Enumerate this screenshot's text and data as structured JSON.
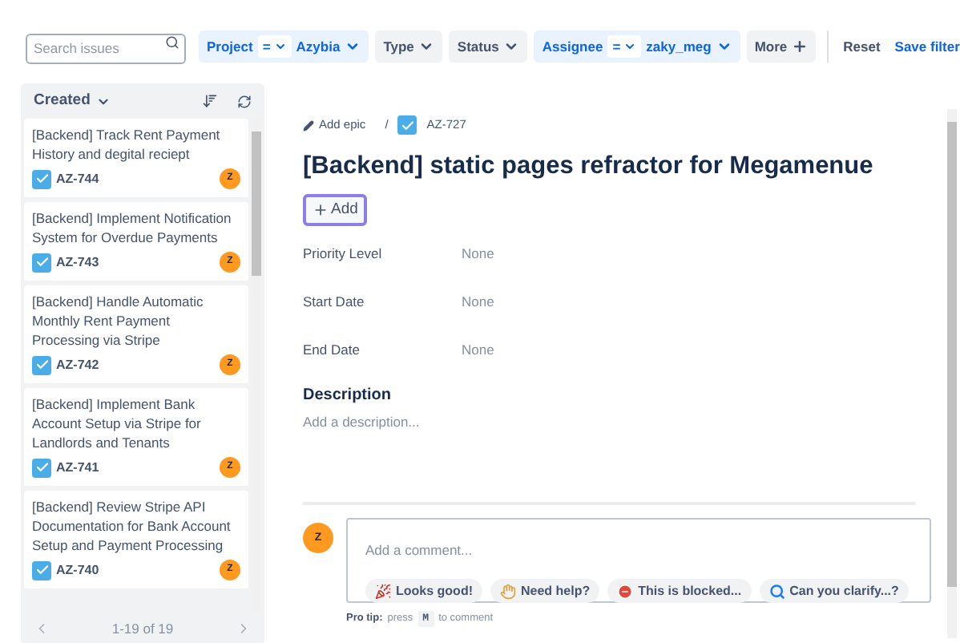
{
  "filters": {
    "search": {
      "placeholder": "Search issues"
    },
    "chips": [
      {
        "kind": "field",
        "label": "Project",
        "operator": "=",
        "value": "Azybia",
        "active": true
      },
      {
        "kind": "simple",
        "label": "Type",
        "active": false
      },
      {
        "kind": "simple",
        "label": "Status",
        "active": false
      },
      {
        "kind": "field",
        "label": "Assignee",
        "operator": "=",
        "value": "zaky_meg",
        "active": true
      },
      {
        "kind": "more",
        "label": "More",
        "active": false
      }
    ],
    "reset": "Reset",
    "save": "Save filter"
  },
  "issue_list": {
    "sort": "Created",
    "items": [
      {
        "title": "[Backend] Track Rent Payment History and degital reciept",
        "key": "AZ-744",
        "avatar": "Z"
      },
      {
        "title": "[Backend] Implement Notification System for Overdue Payments",
        "key": "AZ-743",
        "avatar": "Z"
      },
      {
        "title": "[Backend] Handle Automatic Monthly Rent Payment Processing via Stripe",
        "key": "AZ-742",
        "avatar": "Z"
      },
      {
        "title": "[Backend] Implement Bank Account Setup via Stripe for Landlords and Tenants",
        "key": "AZ-741",
        "avatar": "Z"
      },
      {
        "title": "[Backend] Review Stripe API Documentation for Bank Account Setup and Payment Processing",
        "key": "AZ-740",
        "avatar": "Z"
      }
    ],
    "pagination": "1-19 of 19"
  },
  "issue": {
    "breadcrumb": {
      "epic": "Add epic",
      "separator": "/",
      "key": "AZ-727"
    },
    "title": "[Backend] static pages refractor for Megamenue",
    "add_button": "Add",
    "fields": [
      {
        "label": "Priority Level",
        "value": "None"
      },
      {
        "label": "Start Date",
        "value": "None"
      },
      {
        "label": "End Date",
        "value": "None"
      }
    ],
    "description": {
      "heading": "Description",
      "placeholder": "Add a description..."
    },
    "comment": {
      "avatar": "Z",
      "placeholder": "Add a comment...",
      "quick_replies": [
        {
          "kind": "party",
          "label": "Looks good!"
        },
        {
          "kind": "wave",
          "label": "Need help?"
        },
        {
          "kind": "blocked",
          "label": "This is blocked..."
        },
        {
          "kind": "search",
          "label": "Can you clarify...?"
        }
      ],
      "tip_label": "Pro tip:",
      "tip_before": "press",
      "tip_key": "M",
      "tip_after": "to comment"
    }
  }
}
